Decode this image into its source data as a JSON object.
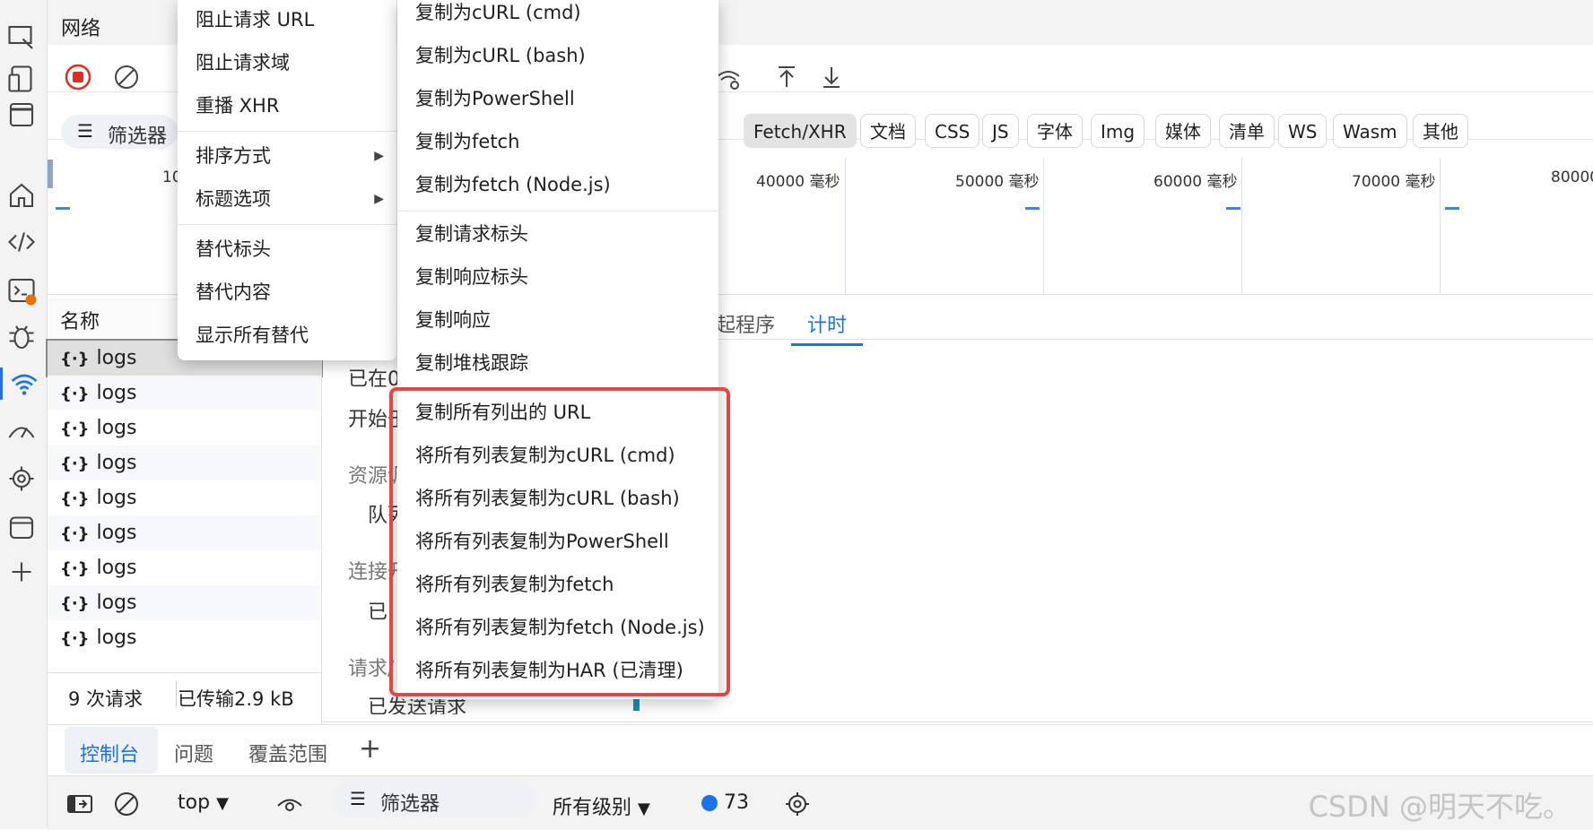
{
  "panel": {
    "title": "网络"
  },
  "activity_icons": [
    "inspect-icon",
    "device-emulation-icon",
    "browser-window-icon",
    "home-icon",
    "elements-code-icon",
    "console-icon",
    "debugger-bug-icon",
    "network-wifi-icon",
    "performance-icon",
    "settings-gear-icon",
    "application-icon",
    "add-icon"
  ],
  "filter": {
    "label": "筛选器"
  },
  "type_filters": [
    "Fetch/XHR",
    "文档",
    "CSS",
    "JS",
    "字体",
    "Img",
    "媒体",
    "清单",
    "WS",
    "Wasm",
    "其他"
  ],
  "timeline": {
    "ticks": [
      "10",
      "40000 毫秒",
      "50000 毫秒",
      "60000 毫秒",
      "70000 毫秒",
      "80000"
    ]
  },
  "request_list": {
    "header": "名称",
    "items": [
      "logs",
      "logs",
      "logs",
      "logs",
      "logs",
      "logs",
      "logs",
      "logs",
      "logs"
    ],
    "status_requests": "9 次请求",
    "status_transferred": "已传输2.9 kB"
  },
  "details": {
    "tabs": {
      "initiator": "起程序",
      "timing": "计时"
    },
    "lines": [
      "已在0",
      "开始于",
      "资源调",
      "队列",
      "连接开",
      "已",
      "请求/",
      "已发送请求"
    ]
  },
  "drawer": {
    "tabs": [
      "控制台",
      "问题",
      "覆盖范围"
    ],
    "add": "+"
  },
  "console_bar": {
    "context": "top",
    "filter": "筛选器",
    "levels": "所有级别",
    "message_count": "73"
  },
  "watermark": "CSDN @明天不吃。",
  "context_menu_left": {
    "items": [
      "阻止请求 URL",
      "阻止请求域",
      "重播 XHR",
      "排序方式",
      "标题选项",
      "替代标头",
      "替代内容",
      "显示所有替代"
    ]
  },
  "context_menu_copy": {
    "items": [
      "复制为cURL (cmd)",
      "复制为cURL (bash)",
      "复制为PowerShell",
      "复制为fetch",
      "复制为fetch (Node.js)",
      "复制请求标头",
      "复制响应标头",
      "复制响应",
      "复制堆栈跟踪",
      "复制所有列出的 URL",
      "将所有列表复制为cURL (cmd)",
      "将所有列表复制为cURL (bash)",
      "将所有列表复制为PowerShell",
      "将所有列表复制为fetch",
      "将所有列表复制为fetch (Node.js)",
      "将所有列表复制为HAR (已清理)"
    ]
  },
  "colors": {
    "accent": "#1a73e8",
    "highlight": "#e64545",
    "record": "#d93025"
  }
}
